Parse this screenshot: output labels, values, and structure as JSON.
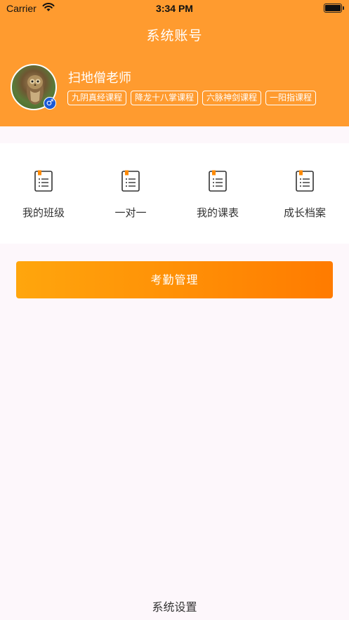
{
  "status_bar": {
    "carrier": "Carrier",
    "time": "3:34 PM"
  },
  "header": {
    "title": "系统账号",
    "user_name": "扫地僧老师",
    "courses": [
      "九阴真经课程",
      "降龙十八掌课程",
      "六脉神剑课程",
      "一阳指课程"
    ],
    "gender_symbol": "♂",
    "bg_color": "#ff9b2f"
  },
  "menu": {
    "items": [
      {
        "label": "我的班级",
        "icon": "notebook-icon"
      },
      {
        "label": "一对一",
        "icon": "notebook-icon"
      },
      {
        "label": "我的课表",
        "icon": "notebook-icon"
      },
      {
        "label": "成长档案",
        "icon": "notebook-icon"
      }
    ]
  },
  "attendance_button": {
    "label": "考勤管理"
  },
  "footer": {
    "settings_label": "系统设置"
  }
}
